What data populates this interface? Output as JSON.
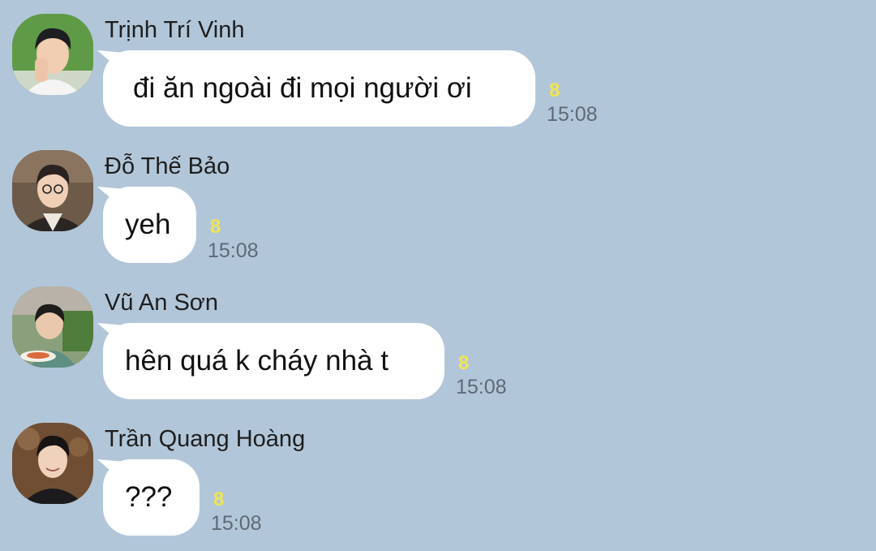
{
  "messages": [
    {
      "sender": "Trịnh Trí Vinh",
      "text": "đi ăn ngoài đi mọi người ơi",
      "unread": "8",
      "time": "15:08"
    },
    {
      "sender": "Đỗ Thế Bảo",
      "text": "yeh",
      "unread": "8",
      "time": "15:08"
    },
    {
      "sender": "Vũ An Sơn",
      "text": "hên quá k cháy nhà t",
      "unread": "8",
      "time": "15:08"
    },
    {
      "sender": "Trần Quang Hoàng",
      "text": "???",
      "unread": "8",
      "time": "15:08"
    }
  ],
  "colors": {
    "background": "#b2c6d9",
    "bubble": "#ffffff",
    "unread_count": "#f0e552",
    "timestamp": "#5e6a76"
  }
}
